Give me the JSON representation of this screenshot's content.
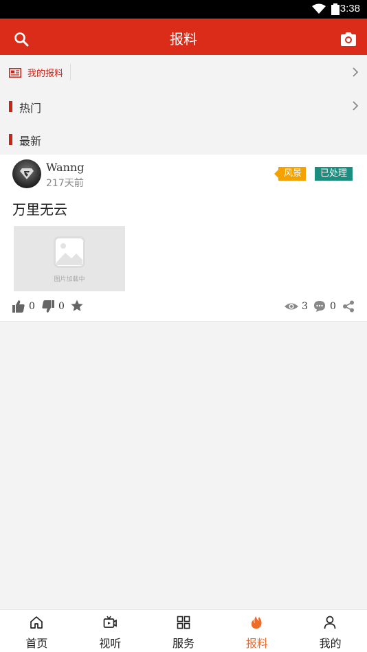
{
  "status_bar": {
    "time": "3:38"
  },
  "header": {
    "title": "报料",
    "search_icon": "search-icon",
    "camera_icon": "camera-icon"
  },
  "menu": {
    "my_reports": "我的报料",
    "hot": "热门",
    "latest": "最新"
  },
  "post": {
    "username": "Wanng",
    "time_ago": "217天前",
    "category": "风景",
    "status": "已处理",
    "title": "万里无云",
    "image_placeholder": "图片加载中",
    "likes": "0",
    "dislikes": "0",
    "views": "3",
    "comments": "0"
  },
  "colors": {
    "brand": "#db2c1a",
    "accent": "#f06a28",
    "tag_category": "#f3a200",
    "tag_status": "#1b8e80"
  },
  "tabs": [
    {
      "label": "首页",
      "icon": "home-icon"
    },
    {
      "label": "视听",
      "icon": "tv-icon"
    },
    {
      "label": "服务",
      "icon": "grid-icon"
    },
    {
      "label": "报料",
      "icon": "flame-icon",
      "active": true
    },
    {
      "label": "我的",
      "icon": "user-icon"
    }
  ]
}
